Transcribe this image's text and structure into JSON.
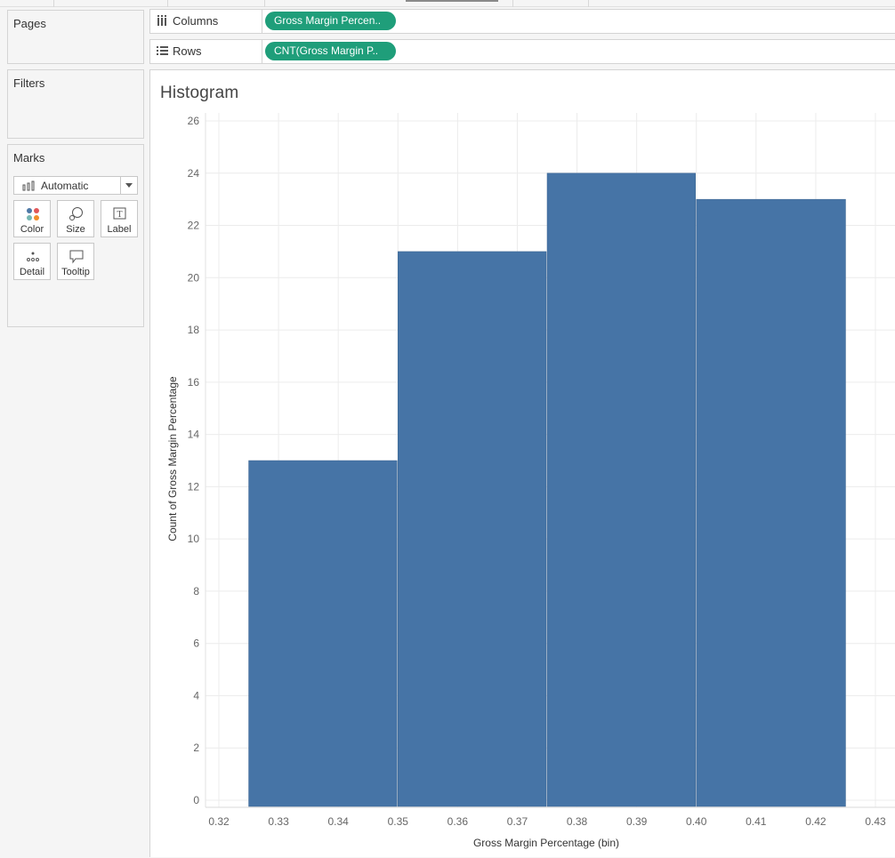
{
  "left_panel": {
    "pages_title": "Pages",
    "filters_title": "Filters",
    "marks_title": "Marks",
    "mark_type": "Automatic",
    "mark_buttons": [
      {
        "label": "Color",
        "icon": "color-icon"
      },
      {
        "label": "Size",
        "icon": "size-icon"
      },
      {
        "label": "Label",
        "icon": "label-icon"
      },
      {
        "label": "Detail",
        "icon": "detail-icon"
      },
      {
        "label": "Tooltip",
        "icon": "tooltip-icon"
      }
    ]
  },
  "shelves": {
    "columns": {
      "label": "Columns",
      "pill": "Gross Margin Percen.."
    },
    "rows": {
      "label": "Rows",
      "pill": "CNT(Gross Margin P.."
    }
  },
  "colors": {
    "bar": "#4674a6",
    "pill": "#1f9e7a",
    "grid": "#ececec"
  },
  "chart_data": {
    "type": "bar",
    "title": "Histogram",
    "xlabel": "Gross Margin Percentage (bin)",
    "ylabel": "Count of Gross Margin Percentage",
    "bins": [
      {
        "start": 0.325,
        "end": 0.35,
        "value": 13
      },
      {
        "start": 0.35,
        "end": 0.375,
        "value": 21
      },
      {
        "start": 0.375,
        "end": 0.4,
        "value": 24
      },
      {
        "start": 0.4,
        "end": 0.425,
        "value": 23
      }
    ],
    "xlim": [
      0.32,
      0.43
    ],
    "ylim": [
      0,
      26
    ],
    "xticks": [
      "0.32",
      "0.33",
      "0.34",
      "0.35",
      "0.36",
      "0.37",
      "0.38",
      "0.39",
      "0.40",
      "0.41",
      "0.42",
      "0.43"
    ],
    "yticks": [
      "0",
      "2",
      "4",
      "6",
      "8",
      "10",
      "12",
      "14",
      "16",
      "18",
      "20",
      "22",
      "24",
      "26"
    ],
    "grid": true
  }
}
